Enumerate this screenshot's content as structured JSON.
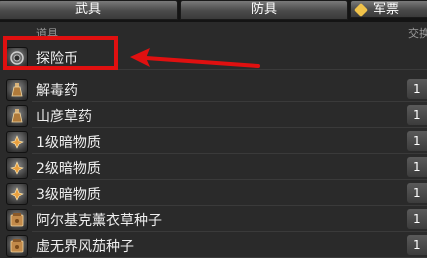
{
  "tabs": {
    "weapons": "武具",
    "armor": "防具",
    "other": "军票"
  },
  "columns": {
    "item": "道具",
    "trade": "交换"
  },
  "items": [
    {
      "name": "探险币",
      "qty": "",
      "icon": "coin-icon"
    },
    {
      "name": "解毒药",
      "qty": "1",
      "icon": "potion-icon"
    },
    {
      "name": "山彦草药",
      "qty": "1",
      "icon": "potion-icon"
    },
    {
      "name": "1级暗物质",
      "qty": "1",
      "icon": "dark-matter-icon"
    },
    {
      "name": "2级暗物质",
      "qty": "1",
      "icon": "dark-matter-icon"
    },
    {
      "name": "3级暗物质",
      "qty": "1",
      "icon": "dark-matter-icon"
    },
    {
      "name": "阿尔基克薰衣草种子",
      "qty": "1",
      "icon": "seed-bag-icon"
    },
    {
      "name": "虚无界风茄种子",
      "qty": "1",
      "icon": "seed-bag-icon"
    }
  ],
  "colors": {
    "highlight": "#e01010",
    "background": "#2a2a2a"
  }
}
